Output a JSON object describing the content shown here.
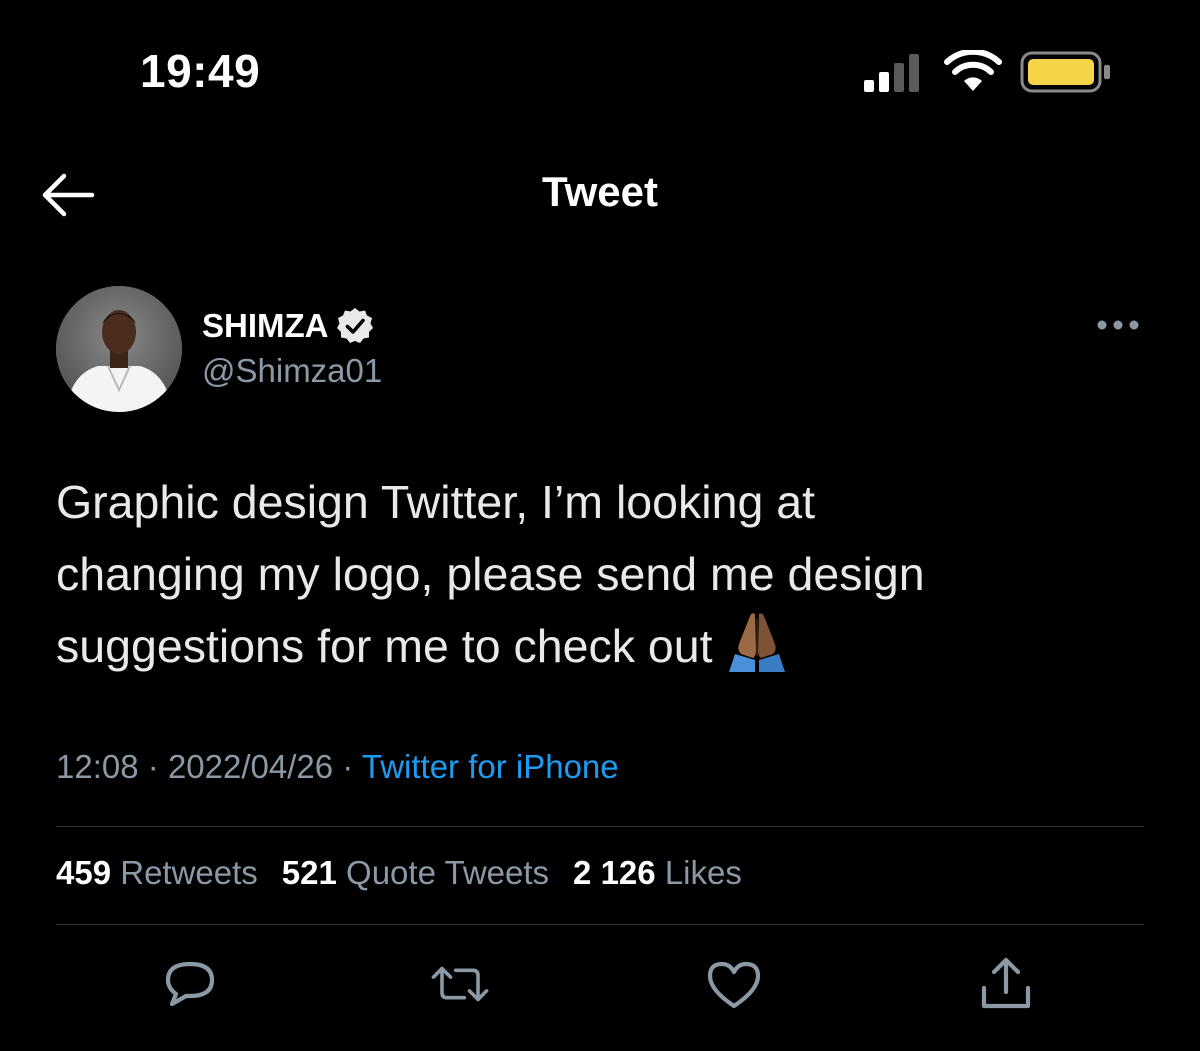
{
  "status_bar": {
    "time": "19:49",
    "icons": [
      "cellular-signal-icon",
      "wifi-icon",
      "battery-icon"
    ]
  },
  "nav": {
    "title": "Tweet",
    "back_icon": "back-arrow-icon"
  },
  "tweet": {
    "author": {
      "display_name": "SHIMZA",
      "handle": "@Shimza01",
      "verified": true
    },
    "text": "Graphic design Twitter, I’m looking at\nchanging my logo, please send me design\nsuggestions for me to check out",
    "emoji": "folded-hands-emoji",
    "time": "12:08",
    "separator": "·",
    "date": "2022/04/26",
    "source": "Twitter for iPhone"
  },
  "stats": {
    "retweets_count": "459",
    "retweets_label": "Retweets",
    "quotes_count": "521",
    "quotes_label": "Quote Tweets",
    "likes_count": "2 126",
    "likes_label": "Likes"
  },
  "actions": [
    "reply-icon",
    "retweet-icon",
    "like-icon",
    "share-icon"
  ],
  "colors": {
    "background": "#000000",
    "text": "#e7e9ea",
    "secondary_text": "#8b98a5",
    "link": "#1d9bf0",
    "divider": "#2f3336",
    "battery": "#f5d547"
  }
}
